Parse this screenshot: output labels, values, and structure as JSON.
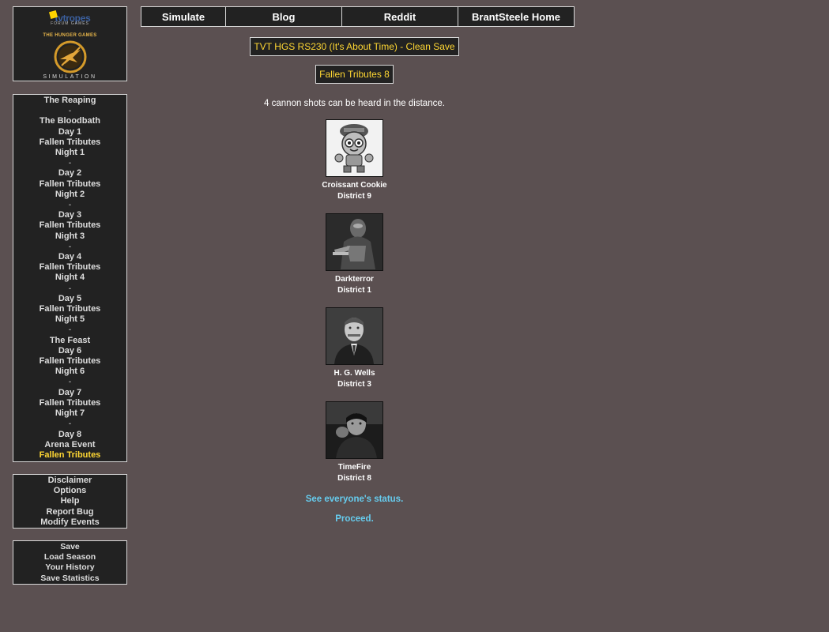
{
  "logo": {
    "brand": "tvtropes",
    "subbrand": "FORUM GAMES",
    "game": "THE HUNGER GAMES",
    "subtitle": "SIMULATION"
  },
  "top_nav": [
    {
      "label": "Simulate"
    },
    {
      "label": "Blog"
    },
    {
      "label": "Reddit"
    },
    {
      "label": "BrantSteele Home"
    }
  ],
  "sidebar": {
    "rounds": [
      {
        "label": "The Reaping"
      },
      {
        "label": "-"
      },
      {
        "label": "The Bloodbath"
      },
      {
        "label": "Day 1"
      },
      {
        "label": "Fallen Tributes"
      },
      {
        "label": "Night 1"
      },
      {
        "label": "-"
      },
      {
        "label": "Day 2"
      },
      {
        "label": "Fallen Tributes"
      },
      {
        "label": "Night 2"
      },
      {
        "label": "-"
      },
      {
        "label": "Day 3"
      },
      {
        "label": "Fallen Tributes"
      },
      {
        "label": "Night 3"
      },
      {
        "label": "-"
      },
      {
        "label": "Day 4"
      },
      {
        "label": "Fallen Tributes"
      },
      {
        "label": "Night 4"
      },
      {
        "label": "-"
      },
      {
        "label": "Day 5"
      },
      {
        "label": "Fallen Tributes"
      },
      {
        "label": "Night 5"
      },
      {
        "label": "-"
      },
      {
        "label": "The Feast"
      },
      {
        "label": "Day 6"
      },
      {
        "label": "Fallen Tributes"
      },
      {
        "label": "Night 6"
      },
      {
        "label": "-"
      },
      {
        "label": "Day 7"
      },
      {
        "label": "Fallen Tributes"
      },
      {
        "label": "Night 7"
      },
      {
        "label": "-"
      },
      {
        "label": "Day 8"
      },
      {
        "label": "Arena Event"
      },
      {
        "label": "Fallen Tributes"
      }
    ],
    "active_round_index": 34,
    "info_links": [
      {
        "label": "Disclaimer"
      },
      {
        "label": "Options"
      },
      {
        "label": "Help"
      },
      {
        "label": "Report Bug"
      },
      {
        "label": "Modify Events"
      }
    ],
    "save_links": [
      {
        "label": "Save"
      },
      {
        "label": "Load Season"
      },
      {
        "label": "Your History"
      },
      {
        "label": "Save Statistics"
      }
    ]
  },
  "main": {
    "season_title": "TVT HGS RS230 (It's About Time) - Clean Save",
    "event_title": "Fallen Tributes 8",
    "message": "4 cannon shots can be heard in the distance.",
    "tributes": [
      {
        "name": "Croissant Cookie",
        "district": "District 9",
        "portrait_icon": "cartoon-cookie-portrait"
      },
      {
        "name": "Darkterror",
        "district": "District 1",
        "portrait_icon": "armored-figure-portrait"
      },
      {
        "name": "H. G. Wells",
        "district": "District 3",
        "portrait_icon": "man-in-suit-portrait"
      },
      {
        "name": "TimeFire",
        "district": "District 8",
        "portrait_icon": "person-photo-portrait"
      }
    ],
    "status_link": "See everyone's status.",
    "proceed_link": "Proceed."
  },
  "colors": {
    "background": "#5b5051",
    "panel": "#222222",
    "highlight": "#ffd733",
    "link": "#66ccee"
  }
}
